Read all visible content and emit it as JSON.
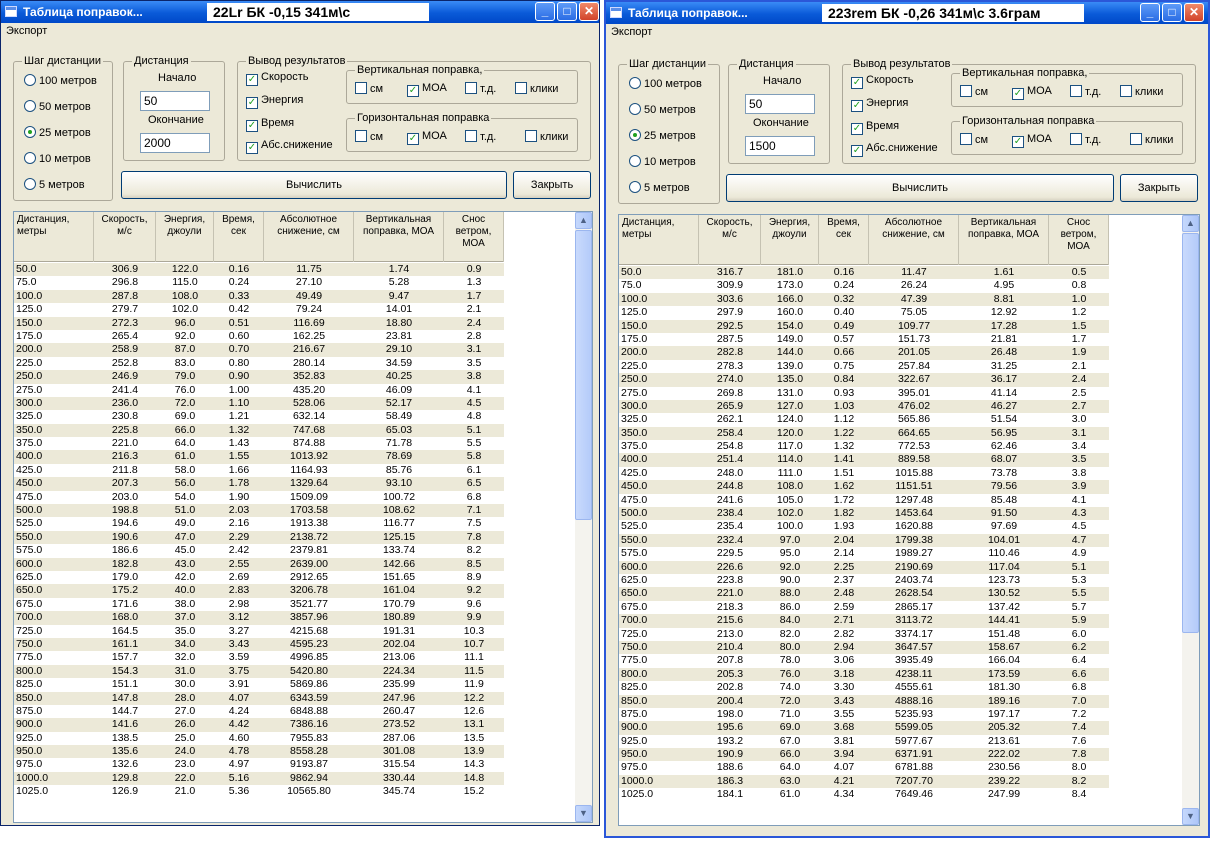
{
  "windows": [
    {
      "title": "Таблица поправок...",
      "title_label": "22Lr  БК -0,15  341м\\с",
      "menu": {
        "export": "Экспорт"
      },
      "step": {
        "group_title": "Шаг дистанции",
        "options": [
          "100 метров",
          "50 метров",
          "25 метров",
          "10 метров",
          "5 метров"
        ],
        "selected": 2
      },
      "distance": {
        "group_title": "Дистанция",
        "start_label": "Начало",
        "start_value": "50",
        "end_label": "Окончание",
        "end_value": "2000"
      },
      "output": {
        "group_title": "Вывод результатов",
        "checks": [
          "Скорость",
          "Энергия",
          "Время",
          "Абс.снижение"
        ]
      },
      "vertical": {
        "group_title": "Вертикальная поправка,",
        "units": [
          "см",
          "МОА",
          "т.д.",
          "клики"
        ],
        "checked": 1
      },
      "horizontal": {
        "group_title": "Горизонтальная поправка",
        "units": [
          "см",
          "МОА",
          "т.д.",
          "клики"
        ],
        "checked": 1
      },
      "buttons": {
        "calculate": "Вычислить",
        "close": "Закрыть"
      },
      "table": {
        "headers": [
          "Дистанция, метры",
          "Скорость, м/с",
          "Энергия, джоули",
          "Время, сек",
          "Абсолютное снижение, см",
          "Вертикальная поправка, МОА",
          "Снос ветром, МОА"
        ],
        "rows": [
          [
            "50.0",
            "306.9",
            "122.0",
            "0.16",
            "11.75",
            "1.74",
            "0.9"
          ],
          [
            "75.0",
            "296.8",
            "115.0",
            "0.24",
            "27.10",
            "5.28",
            "1.3"
          ],
          [
            "100.0",
            "287.8",
            "108.0",
            "0.33",
            "49.49",
            "9.47",
            "1.7"
          ],
          [
            "125.0",
            "279.7",
            "102.0",
            "0.42",
            "79.24",
            "14.01",
            "2.1"
          ],
          [
            "150.0",
            "272.3",
            "96.0",
            "0.51",
            "116.69",
            "18.80",
            "2.4"
          ],
          [
            "175.0",
            "265.4",
            "92.0",
            "0.60",
            "162.25",
            "23.81",
            "2.8"
          ],
          [
            "200.0",
            "258.9",
            "87.0",
            "0.70",
            "216.67",
            "29.10",
            "3.1"
          ],
          [
            "225.0",
            "252.8",
            "83.0",
            "0.80",
            "280.14",
            "34.59",
            "3.5"
          ],
          [
            "250.0",
            "246.9",
            "79.0",
            "0.90",
            "352.83",
            "40.25",
            "3.8"
          ],
          [
            "275.0",
            "241.4",
            "76.0",
            "1.00",
            "435.20",
            "46.09",
            "4.1"
          ],
          [
            "300.0",
            "236.0",
            "72.0",
            "1.10",
            "528.06",
            "52.17",
            "4.5"
          ],
          [
            "325.0",
            "230.8",
            "69.0",
            "1.21",
            "632.14",
            "58.49",
            "4.8"
          ],
          [
            "350.0",
            "225.8",
            "66.0",
            "1.32",
            "747.68",
            "65.03",
            "5.1"
          ],
          [
            "375.0",
            "221.0",
            "64.0",
            "1.43",
            "874.88",
            "71.78",
            "5.5"
          ],
          [
            "400.0",
            "216.3",
            "61.0",
            "1.55",
            "1013.92",
            "78.69",
            "5.8"
          ],
          [
            "425.0",
            "211.8",
            "58.0",
            "1.66",
            "1164.93",
            "85.76",
            "6.1"
          ],
          [
            "450.0",
            "207.3",
            "56.0",
            "1.78",
            "1329.64",
            "93.10",
            "6.5"
          ],
          [
            "475.0",
            "203.0",
            "54.0",
            "1.90",
            "1509.09",
            "100.72",
            "6.8"
          ],
          [
            "500.0",
            "198.8",
            "51.0",
            "2.03",
            "1703.58",
            "108.62",
            "7.1"
          ],
          [
            "525.0",
            "194.6",
            "49.0",
            "2.16",
            "1913.38",
            "116.77",
            "7.5"
          ],
          [
            "550.0",
            "190.6",
            "47.0",
            "2.29",
            "2138.72",
            "125.15",
            "7.8"
          ],
          [
            "575.0",
            "186.6",
            "45.0",
            "2.42",
            "2379.81",
            "133.74",
            "8.2"
          ],
          [
            "600.0",
            "182.8",
            "43.0",
            "2.55",
            "2639.00",
            "142.66",
            "8.5"
          ],
          [
            "625.0",
            "179.0",
            "42.0",
            "2.69",
            "2912.65",
            "151.65",
            "8.9"
          ],
          [
            "650.0",
            "175.2",
            "40.0",
            "2.83",
            "3206.78",
            "161.04",
            "9.2"
          ],
          [
            "675.0",
            "171.6",
            "38.0",
            "2.98",
            "3521.77",
            "170.79",
            "9.6"
          ],
          [
            "700.0",
            "168.0",
            "37.0",
            "3.12",
            "3857.96",
            "180.89",
            "9.9"
          ],
          [
            "725.0",
            "164.5",
            "35.0",
            "3.27",
            "4215.68",
            "191.31",
            "10.3"
          ],
          [
            "750.0",
            "161.1",
            "34.0",
            "3.43",
            "4595.23",
            "202.04",
            "10.7"
          ],
          [
            "775.0",
            "157.7",
            "32.0",
            "3.59",
            "4996.85",
            "213.06",
            "11.1"
          ],
          [
            "800.0",
            "154.3",
            "31.0",
            "3.75",
            "5420.80",
            "224.34",
            "11.5"
          ],
          [
            "825.0",
            "151.1",
            "30.0",
            "3.91",
            "5869.86",
            "235.99",
            "11.9"
          ],
          [
            "850.0",
            "147.8",
            "28.0",
            "4.07",
            "6343.59",
            "247.96",
            "12.2"
          ],
          [
            "875.0",
            "144.7",
            "27.0",
            "4.24",
            "6848.88",
            "260.47",
            "12.6"
          ],
          [
            "900.0",
            "141.6",
            "26.0",
            "4.42",
            "7386.16",
            "273.52",
            "13.1"
          ],
          [
            "925.0",
            "138.5",
            "25.0",
            "4.60",
            "7955.83",
            "287.06",
            "13.5"
          ],
          [
            "950.0",
            "135.6",
            "24.0",
            "4.78",
            "8558.28",
            "301.08",
            "13.9"
          ],
          [
            "975.0",
            "132.6",
            "23.0",
            "4.97",
            "9193.87",
            "315.54",
            "14.3"
          ],
          [
            "1000.0",
            "129.8",
            "22.0",
            "5.16",
            "9862.94",
            "330.44",
            "14.8"
          ],
          [
            "1025.0",
            "126.9",
            "21.0",
            "5.36",
            "10565.80",
            "345.74",
            "15.2"
          ]
        ]
      }
    },
    {
      "title": "Таблица поправок...",
      "title_label": "223rem  БК -0,26  341м\\с  3.6грам",
      "menu": {
        "export": "Экспорт"
      },
      "step": {
        "group_title": "Шаг дистанции",
        "options": [
          "100 метров",
          "50 метров",
          "25 метров",
          "10 метров",
          "5 метров"
        ],
        "selected": 2
      },
      "distance": {
        "group_title": "Дистанция",
        "start_label": "Начало",
        "start_value": "50",
        "end_label": "Окончание",
        "end_value": "1500"
      },
      "output": {
        "group_title": "Вывод результатов",
        "checks": [
          "Скорость",
          "Энергия",
          "Время",
          "Абс.снижение"
        ]
      },
      "vertical": {
        "group_title": "Вертикальная поправка,",
        "units": [
          "см",
          "МОА",
          "т.д.",
          "клики"
        ],
        "checked": 1
      },
      "horizontal": {
        "group_title": "Горизонтальная поправка",
        "units": [
          "см",
          "МОА",
          "т.д.",
          "клики"
        ],
        "checked": 1
      },
      "buttons": {
        "calculate": "Вычислить",
        "close": "Закрыть"
      },
      "table": {
        "headers": [
          "Дистанция, метры",
          "Скорость, м/с",
          "Энергия, джоули",
          "Время, сек",
          "Абсолютное снижение, см",
          "Вертикальная поправка, МОА",
          "Снос ветром, МОА"
        ],
        "rows": [
          [
            "50.0",
            "316.7",
            "181.0",
            "0.16",
            "11.47",
            "1.61",
            "0.5"
          ],
          [
            "75.0",
            "309.9",
            "173.0",
            "0.24",
            "26.24",
            "4.95",
            "0.8"
          ],
          [
            "100.0",
            "303.6",
            "166.0",
            "0.32",
            "47.39",
            "8.81",
            "1.0"
          ],
          [
            "125.0",
            "297.9",
            "160.0",
            "0.40",
            "75.05",
            "12.92",
            "1.2"
          ],
          [
            "150.0",
            "292.5",
            "154.0",
            "0.49",
            "109.77",
            "17.28",
            "1.5"
          ],
          [
            "175.0",
            "287.5",
            "149.0",
            "0.57",
            "151.73",
            "21.81",
            "1.7"
          ],
          [
            "200.0",
            "282.8",
            "144.0",
            "0.66",
            "201.05",
            "26.48",
            "1.9"
          ],
          [
            "225.0",
            "278.3",
            "139.0",
            "0.75",
            "257.84",
            "31.25",
            "2.1"
          ],
          [
            "250.0",
            "274.0",
            "135.0",
            "0.84",
            "322.67",
            "36.17",
            "2.4"
          ],
          [
            "275.0",
            "269.8",
            "131.0",
            "0.93",
            "395.01",
            "41.14",
            "2.5"
          ],
          [
            "300.0",
            "265.9",
            "127.0",
            "1.03",
            "476.02",
            "46.27",
            "2.7"
          ],
          [
            "325.0",
            "262.1",
            "124.0",
            "1.12",
            "565.86",
            "51.54",
            "3.0"
          ],
          [
            "350.0",
            "258.4",
            "120.0",
            "1.22",
            "664.65",
            "56.95",
            "3.1"
          ],
          [
            "375.0",
            "254.8",
            "117.0",
            "1.32",
            "772.53",
            "62.46",
            "3.4"
          ],
          [
            "400.0",
            "251.4",
            "114.0",
            "1.41",
            "889.58",
            "68.07",
            "3.5"
          ],
          [
            "425.0",
            "248.0",
            "111.0",
            "1.51",
            "1015.88",
            "73.78",
            "3.8"
          ],
          [
            "450.0",
            "244.8",
            "108.0",
            "1.62",
            "1151.51",
            "79.56",
            "3.9"
          ],
          [
            "475.0",
            "241.6",
            "105.0",
            "1.72",
            "1297.48",
            "85.48",
            "4.1"
          ],
          [
            "500.0",
            "238.4",
            "102.0",
            "1.82",
            "1453.64",
            "91.50",
            "4.3"
          ],
          [
            "525.0",
            "235.4",
            "100.0",
            "1.93",
            "1620.88",
            "97.69",
            "4.5"
          ],
          [
            "550.0",
            "232.4",
            "97.0",
            "2.04",
            "1799.38",
            "104.01",
            "4.7"
          ],
          [
            "575.0",
            "229.5",
            "95.0",
            "2.14",
            "1989.27",
            "110.46",
            "4.9"
          ],
          [
            "600.0",
            "226.6",
            "92.0",
            "2.25",
            "2190.69",
            "117.04",
            "5.1"
          ],
          [
            "625.0",
            "223.8",
            "90.0",
            "2.37",
            "2403.74",
            "123.73",
            "5.3"
          ],
          [
            "650.0",
            "221.0",
            "88.0",
            "2.48",
            "2628.54",
            "130.52",
            "5.5"
          ],
          [
            "675.0",
            "218.3",
            "86.0",
            "2.59",
            "2865.17",
            "137.42",
            "5.7"
          ],
          [
            "700.0",
            "215.6",
            "84.0",
            "2.71",
            "3113.72",
            "144.41",
            "5.9"
          ],
          [
            "725.0",
            "213.0",
            "82.0",
            "2.82",
            "3374.17",
            "151.48",
            "6.0"
          ],
          [
            "750.0",
            "210.4",
            "80.0",
            "2.94",
            "3647.57",
            "158.67",
            "6.2"
          ],
          [
            "775.0",
            "207.8",
            "78.0",
            "3.06",
            "3935.49",
            "166.04",
            "6.4"
          ],
          [
            "800.0",
            "205.3",
            "76.0",
            "3.18",
            "4238.11",
            "173.59",
            "6.6"
          ],
          [
            "825.0",
            "202.8",
            "74.0",
            "3.30",
            "4555.61",
            "181.30",
            "6.8"
          ],
          [
            "850.0",
            "200.4",
            "72.0",
            "3.43",
            "4888.16",
            "189.16",
            "7.0"
          ],
          [
            "875.0",
            "198.0",
            "71.0",
            "3.55",
            "5235.93",
            "197.17",
            "7.2"
          ],
          [
            "900.0",
            "195.6",
            "69.0",
            "3.68",
            "5599.05",
            "205.32",
            "7.4"
          ],
          [
            "925.0",
            "193.2",
            "67.0",
            "3.81",
            "5977.67",
            "213.61",
            "7.6"
          ],
          [
            "950.0",
            "190.9",
            "66.0",
            "3.94",
            "6371.91",
            "222.02",
            "7.8"
          ],
          [
            "975.0",
            "188.6",
            "64.0",
            "4.07",
            "6781.88",
            "230.56",
            "8.0"
          ],
          [
            "1000.0",
            "186.3",
            "63.0",
            "4.21",
            "7207.70",
            "239.22",
            "8.2"
          ],
          [
            "1025.0",
            "184.1",
            "61.0",
            "4.34",
            "7649.46",
            "247.99",
            "8.4"
          ]
        ]
      }
    }
  ]
}
